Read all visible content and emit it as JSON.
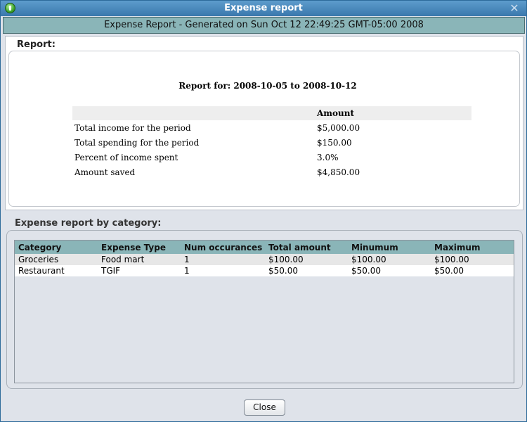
{
  "window": {
    "title": "Expense report",
    "banner": "Expense Report - Generated on Sun Oct 12 22:49:25 GMT-05:00 2008"
  },
  "report": {
    "label": "Report:",
    "title": "Report for: 2008-10-05 to 2008-10-12",
    "column_header": "Amount",
    "rows": [
      {
        "label": "Total income for the period",
        "value": "$5,000.00"
      },
      {
        "label": "Total spending for the period",
        "value": "$150.00"
      },
      {
        "label": "Percent of income spent",
        "value": "3.0%"
      },
      {
        "label": "Amount saved",
        "value": "$4,850.00"
      }
    ]
  },
  "category_report": {
    "label": "Expense report by category:",
    "columns": [
      "Category",
      "Expense Type",
      "Num occurances",
      "Total amount",
      "Minumum",
      "Maximum"
    ],
    "rows": [
      [
        "Groceries",
        "Food mart",
        "1",
        "$100.00",
        "$100.00",
        "$100.00"
      ],
      [
        "Restaurant",
        "TGIF",
        "1",
        "$50.00",
        "$50.00",
        "$50.00"
      ]
    ]
  },
  "buttons": {
    "close_label": "Close"
  },
  "icons": {
    "app": "app-icon",
    "close": "close-icon"
  }
}
